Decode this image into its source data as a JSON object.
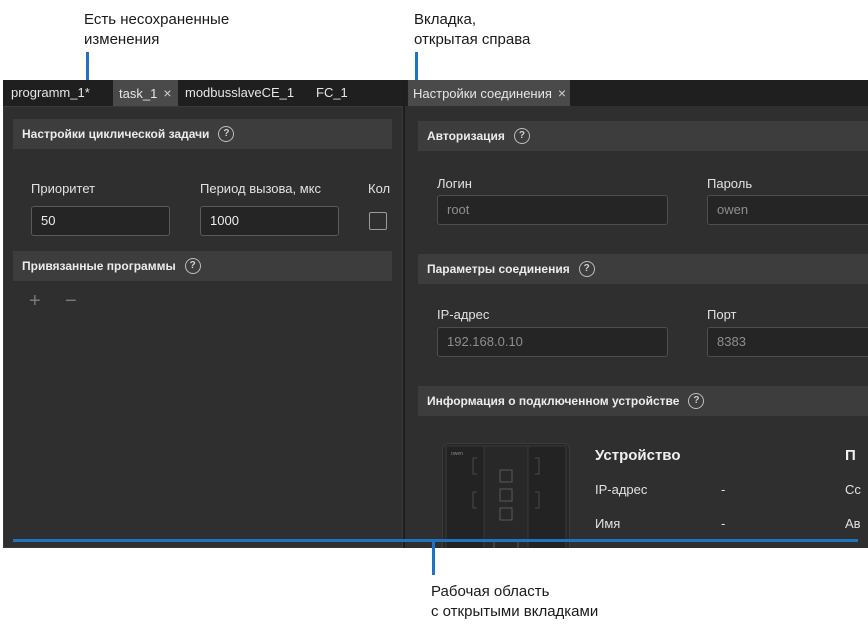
{
  "annotations": {
    "unsaved": [
      "Есть несохраненные",
      "изменения"
    ],
    "right_tab": [
      "Вкладка,",
      "открытая справа"
    ],
    "workspace": [
      "Рабочая область",
      "с открытыми вкладками"
    ],
    "accent_color": "#1f73c0"
  },
  "left_pane": {
    "tabs": [
      {
        "label": "programm_1*",
        "active": false
      },
      {
        "label": "task_1",
        "active": true,
        "closable": true
      },
      {
        "label": "modbusslaveCE_1",
        "active": false
      },
      {
        "label": "FC_1",
        "active": false
      }
    ],
    "close_icon": "×",
    "cyclic_section": {
      "title": "Настройки циклической задачи",
      "help": "?"
    },
    "priority": {
      "label": "Приоритет",
      "value": "50"
    },
    "period": {
      "label": "Период вызова, мкс",
      "value": "1000"
    },
    "kol": {
      "label": "Кол"
    },
    "programs_section": {
      "title": "Привязанные программы",
      "help": "?"
    },
    "add_icon": "+",
    "remove_icon": "−"
  },
  "right_pane": {
    "tabs": [
      {
        "label": "Настройки соединения",
        "active": true,
        "closable": true
      }
    ],
    "close_icon": "×",
    "auth_section": {
      "title": "Авторизация",
      "help": "?"
    },
    "login": {
      "label": "Логин",
      "value": "root"
    },
    "password": {
      "label": "Пароль",
      "value": "owen"
    },
    "conn_section": {
      "title": "Параметры соединения",
      "help": "?"
    },
    "ip": {
      "label": "IP-адрес",
      "value": "192.168.0.10"
    },
    "port": {
      "label": "Порт",
      "value": "8383"
    },
    "device_section": {
      "title": "Информация о подключенном устройстве",
      "help": "?"
    },
    "device_info": {
      "title": "Устройство",
      "title2": "П",
      "rows": [
        {
          "label": "IP-адрес",
          "value": "-",
          "extra": "Сс"
        },
        {
          "label": "Имя",
          "value": "-",
          "extra": "Ав"
        }
      ]
    },
    "device_logo": "owen"
  }
}
